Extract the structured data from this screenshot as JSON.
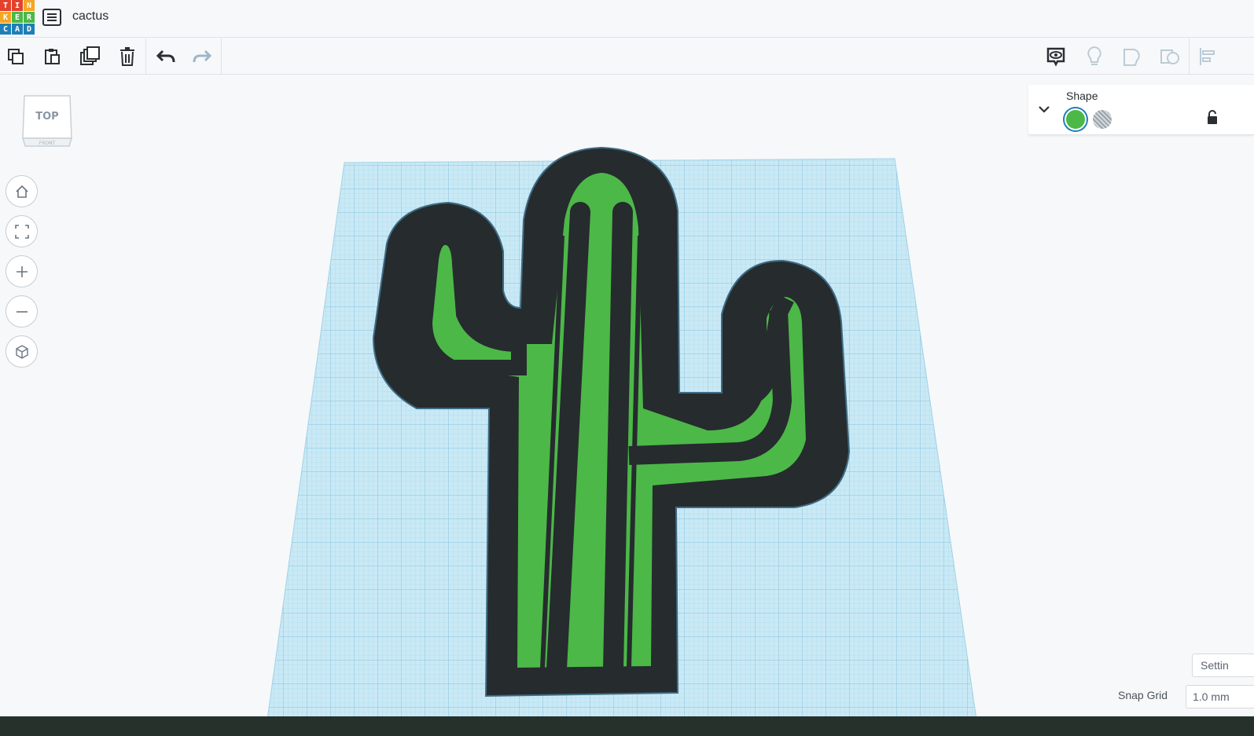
{
  "app": {
    "logo_letters": [
      "T",
      "I",
      "N",
      "K",
      "E",
      "R",
      "C",
      "A",
      "D"
    ],
    "logo_colors": [
      "#e4412c",
      "#e4412c",
      "#f5a623",
      "#f5a623",
      "#4cb848",
      "#4cb848",
      "#1e7fb8",
      "#1e7fb8",
      "#1e7fb8"
    ],
    "design_name": "cactus"
  },
  "toolbar": {
    "copy": "copy-icon",
    "paste": "paste-icon",
    "duplicate": "duplicate-icon",
    "delete": "trash-icon",
    "undo": "undo-icon",
    "redo": "redo-icon",
    "notes": "notes-icon",
    "light": "lightbulb-icon",
    "group": "group-icon",
    "ungroup": "ungroup-icon",
    "align": "align-icon"
  },
  "viewcube": {
    "top_label": "TOP",
    "front_label": "FRONT"
  },
  "nav": [
    "home-icon",
    "fit-view-icon",
    "zoom-in-icon",
    "zoom-out-icon",
    "perspective-icon"
  ],
  "inspector": {
    "title": "Shape",
    "solid_color": "#4cb848",
    "selected": "solid"
  },
  "settings": {
    "label": "Settin"
  },
  "snap_grid": {
    "label": "Snap Grid",
    "value": "1.0 mm"
  },
  "colors": {
    "workplane": "#bfe3f1",
    "grid_line": "#8fcde6",
    "shape_dark": "#262b2e",
    "shape_green": "#4cb848",
    "accent": "#1e7fb8"
  }
}
